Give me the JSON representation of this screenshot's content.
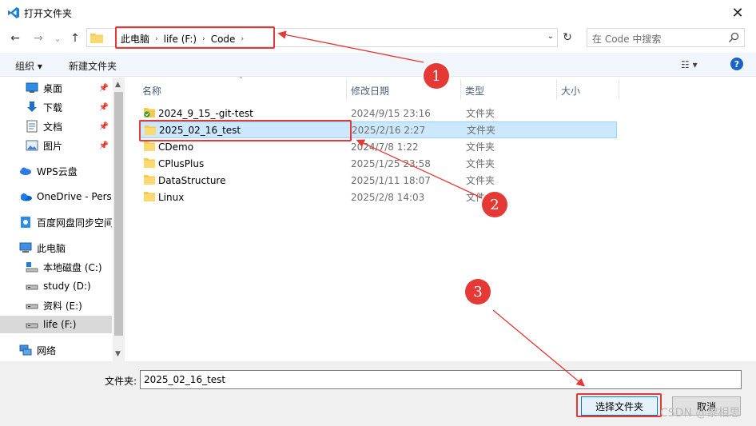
{
  "window": {
    "title": "打开文件夹",
    "app_icon": "vscode-icon",
    "close_label": "✕"
  },
  "nav": {
    "back": "←",
    "forward": "→",
    "recent": "⌄",
    "up": "↑"
  },
  "address": {
    "crumbs": [
      "此电脑",
      "life (F:)",
      "Code"
    ],
    "separator": "›",
    "dropdown": "⌄",
    "refresh": "↻"
  },
  "search": {
    "placeholder": "在 Code 中搜索"
  },
  "toolbar": {
    "organize": "组织 ▾",
    "new_folder": "新建文件夹",
    "view": "☷ ▾",
    "help": "?"
  },
  "sidebar": {
    "items": [
      {
        "label": "桌面",
        "icon": "desktop-icon",
        "pinned": true
      },
      {
        "label": "下载",
        "icon": "download-icon",
        "pinned": true
      },
      {
        "label": "文档",
        "icon": "document-icon",
        "pinned": true
      },
      {
        "label": "图片",
        "icon": "picture-icon",
        "pinned": true
      },
      {
        "label": "WPS云盘",
        "icon": "wps-cloud-icon",
        "pinned": false
      },
      {
        "label": "OneDrive - Perso",
        "icon": "onedrive-icon",
        "pinned": false
      },
      {
        "label": "百度网盘同步空间",
        "icon": "baidu-icon",
        "pinned": false
      },
      {
        "label": "此电脑",
        "icon": "computer-icon",
        "pinned": false
      },
      {
        "label": "本地磁盘 (C:)",
        "icon": "drive-c-icon",
        "pinned": false
      },
      {
        "label": "study (D:)",
        "icon": "drive-icon",
        "pinned": false
      },
      {
        "label": "资料 (E:)",
        "icon": "drive-icon",
        "pinned": false
      },
      {
        "label": "life (F:)",
        "icon": "drive-icon",
        "pinned": false,
        "selected": true
      },
      {
        "label": "网络",
        "icon": "network-icon",
        "pinned": false
      }
    ],
    "pin_glyph": "📌"
  },
  "columns": {
    "name": "名称",
    "date": "修改日期",
    "type": "类型",
    "size": "大小",
    "sort_glyph": "⌃"
  },
  "files": [
    {
      "name": "2024_9_15_-git-test",
      "date": "2024/9/15 23:16",
      "type": "文件夹",
      "synced": true
    },
    {
      "name": "2025_02_16_test",
      "date": "2025/2/16 2:27",
      "type": "文件夹",
      "selected": true
    },
    {
      "name": "CDemo",
      "date": "2024/7/8 1:22",
      "type": "文件夹"
    },
    {
      "name": "CPlusPlus",
      "date": "2025/1/25 23:58",
      "type": "文件夹"
    },
    {
      "name": "DataStructure",
      "date": "2025/1/11 18:07",
      "type": "文件夹"
    },
    {
      "name": "Linux",
      "date": "2025/2/8 14:03",
      "type": "文件夹"
    }
  ],
  "footer": {
    "label": "文件夹:",
    "value": "2025_02_16_test",
    "select_button": "选择文件夹",
    "cancel_button": "取消"
  },
  "annotations": {
    "badge1": "1",
    "badge2": "2",
    "badge3": "3"
  },
  "watermark": "CSDN @黎相思",
  "colors": {
    "annotation_red": "#e53935",
    "folder_yellow": "#f6c94f",
    "selection_blue": "#cce8ff",
    "accent_blue": "#0078d7"
  }
}
